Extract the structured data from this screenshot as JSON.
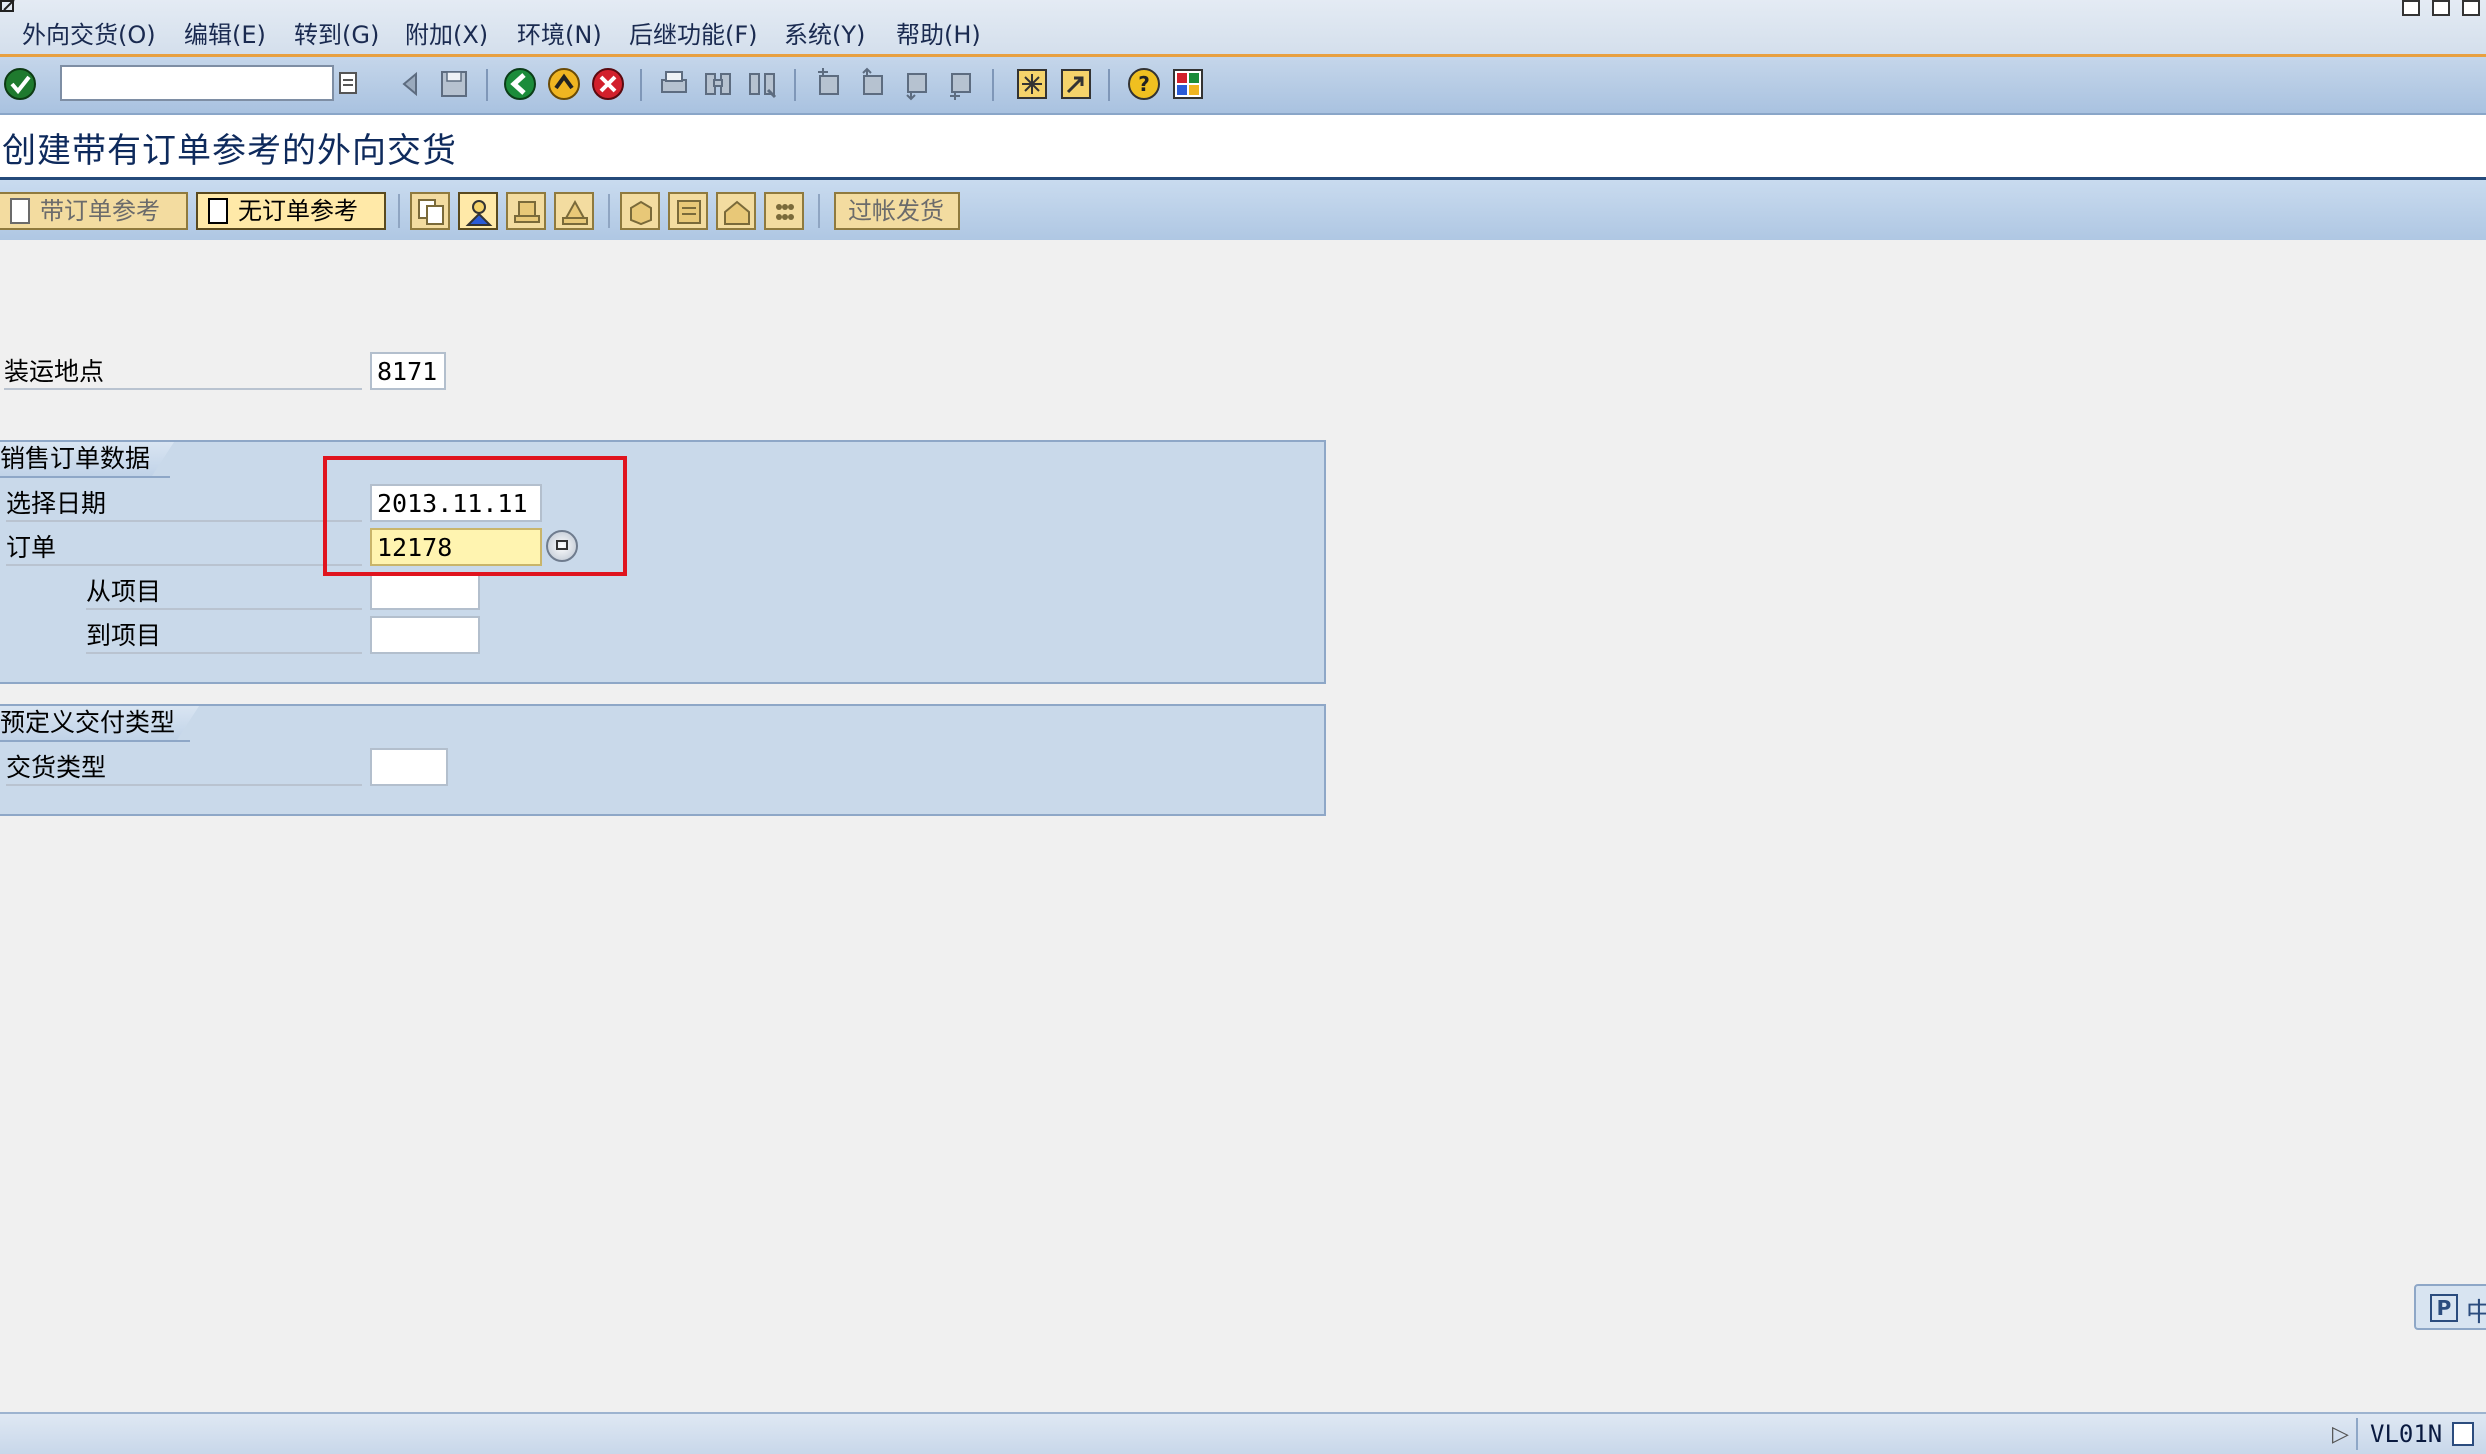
{
  "menu": {
    "items": [
      "外向交货(O)",
      "编辑(E)",
      "转到(G)",
      "附加(X)",
      "环境(N)",
      "后继功能(F)",
      "系统(Y)",
      "帮助(H)"
    ]
  },
  "toolbar": {
    "command_field": {
      "value": ""
    }
  },
  "title": {
    "text": "创建带有订单参考的外向交货"
  },
  "app_toolbar": {
    "with_order_ref": "带订单参考",
    "without_order_ref": "无订单参考",
    "post_goods_issue": "过帐发货"
  },
  "form": {
    "shipping_point": {
      "label": "装运地点",
      "value": "8171"
    },
    "sales_order_group": {
      "title": "销售订单数据",
      "selection_date": {
        "label": "选择日期",
        "value": "2013.11.11"
      },
      "order": {
        "label": "订单",
        "value": "12178"
      },
      "from_item": {
        "label": "从项目",
        "value": ""
      },
      "to_item": {
        "label": "到项目",
        "value": ""
      }
    },
    "delivery_type_group": {
      "title": "预定义交付类型",
      "delivery_type": {
        "label": "交货类型",
        "value": ""
      }
    }
  },
  "side_button": {
    "icon": "P",
    "text": "中"
  },
  "status": {
    "tcode": "VL01N"
  },
  "colors": {
    "accent_orange": "#e8a040",
    "title_navy": "#0e2a5c",
    "group_bg": "#c9d9ea",
    "highlight_red": "#e0141e",
    "focus_yellow": "#fff4b0"
  }
}
